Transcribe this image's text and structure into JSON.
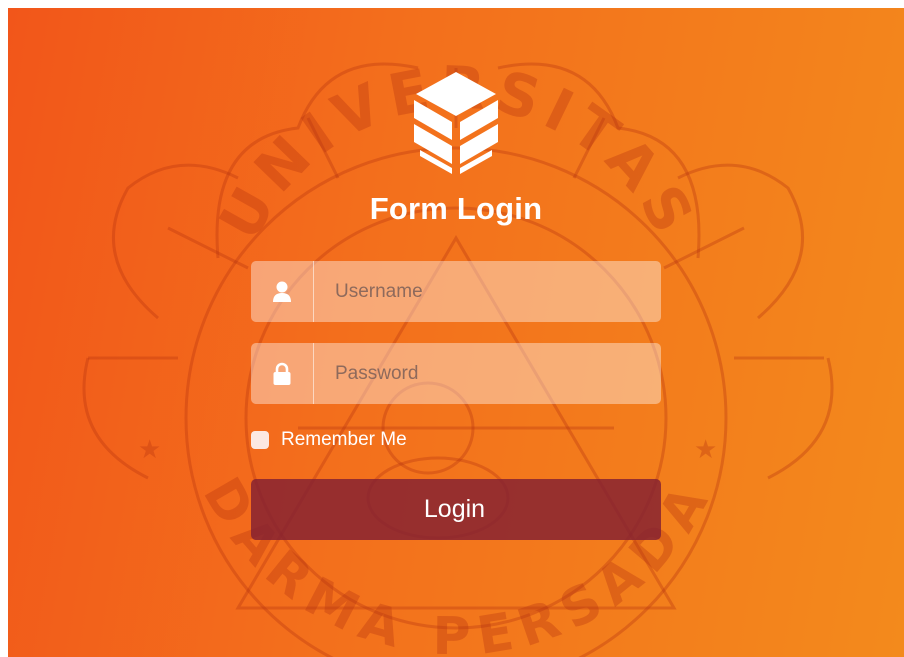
{
  "form": {
    "title": "Form Login",
    "username": {
      "placeholder": "Username",
      "value": ""
    },
    "password": {
      "placeholder": "Password",
      "value": ""
    },
    "remember_label": "Remember Me",
    "remember_checked": false,
    "login_label": "Login"
  },
  "watermark": {
    "top_text": "UNIVERSITAS",
    "bottom_text": "DARMA PERSADA"
  },
  "icons": {
    "logo": "hexagon-box-logo",
    "username": "user-icon",
    "password": "lock-icon"
  },
  "colors": {
    "background_start": "#f2561a",
    "background_end": "#f38a1c",
    "login_button": "#822032",
    "text": "#ffffff"
  }
}
